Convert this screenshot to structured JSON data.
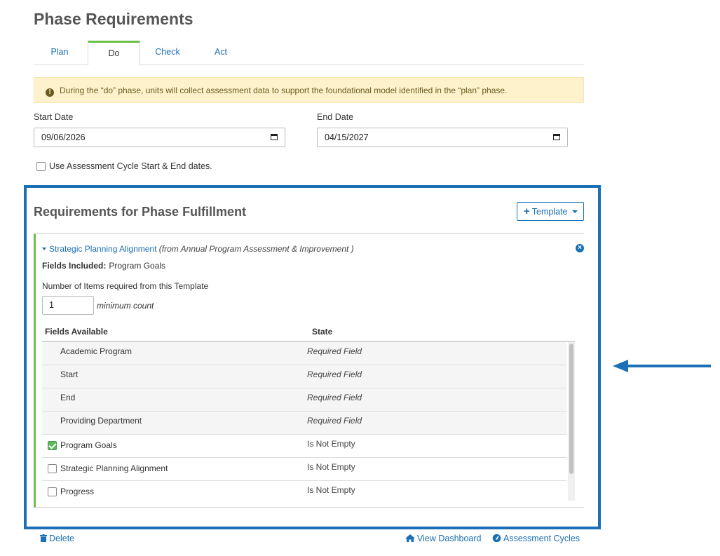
{
  "page": {
    "title": "Phase Requirements"
  },
  "tabs": [
    {
      "label": "Plan"
    },
    {
      "label": "Do"
    },
    {
      "label": "Check"
    },
    {
      "label": "Act"
    }
  ],
  "alert": {
    "text": "During the “do” phase, units will collect assessment data to support the foundational model identified in the “plan” phase."
  },
  "dates": {
    "start_label": "Start Date",
    "start_value": "09/06/2026",
    "end_label": "End Date",
    "end_value": "04/15/2027",
    "use_cycle_label": "Use Assessment Cycle Start & End dates."
  },
  "requirements": {
    "title": "Requirements for Phase Fulfillment",
    "template_button": "Template"
  },
  "template": {
    "name": "Strategic Planning Alignment",
    "source": "(from Annual Program Assessment & Improvement )",
    "fields_included_label": "Fields Included:",
    "fields_included_value": "Program Goals",
    "num_items_label": "Number of Items required from this Template",
    "count_value": "1",
    "min_count_label": "minimum count",
    "col_fields": "Fields Available",
    "col_state": "State",
    "rows": [
      {
        "name": "Academic Program",
        "state": "Required Field"
      },
      {
        "name": "Start",
        "state": "Required Field"
      },
      {
        "name": "End",
        "state": "Required Field"
      },
      {
        "name": "Providing Department",
        "state": "Required Field"
      },
      {
        "name": "Program Goals",
        "state": "Is Not Empty"
      },
      {
        "name": "Strategic Planning Alignment",
        "state": "Is Not Empty"
      },
      {
        "name": "Progress",
        "state": "Is Not Empty"
      }
    ]
  },
  "footer": {
    "delete": "Delete",
    "view_dashboard": "View Dashboard",
    "assessment_cycles": "Assessment Cycles"
  },
  "colors": {
    "link": "#1a6fb5",
    "active_tab_accent": "#6cc04a",
    "highlight_border": "#1a6fb5",
    "alert_bg": "#fdf2cb"
  }
}
